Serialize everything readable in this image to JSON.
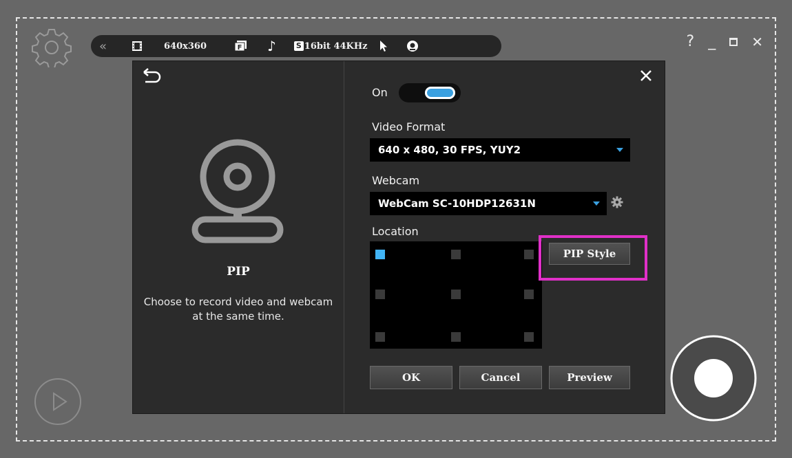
{
  "toolbar": {
    "collapse_icon": "double-chevron-left",
    "video_icon": "film-icon",
    "resolution": "640x360",
    "format_icon": "format-F-icon",
    "audio_icon": "music-note-icon",
    "audio_badge": "S",
    "audio_quality": "16bit 44KHz",
    "cursor_icon": "cursor-arrow-icon",
    "webcam_icon": "webcam-badge-icon"
  },
  "window": {
    "help": "?",
    "minimize": "_",
    "maximize": "□",
    "close": "✕"
  },
  "pip_panel": {
    "title": "PIP",
    "description": "Choose to record video and webcam at the same time."
  },
  "settings": {
    "on_label": "On",
    "toggle_on": true,
    "video_format_label": "Video Format",
    "video_format_value": "640 x 480, 30 FPS, YUY2",
    "webcam_label": "Webcam",
    "webcam_value": "WebCam SC-10HDP12631N",
    "location_label": "Location",
    "location_selected": "top-left",
    "pip_style_button": "PIP Style"
  },
  "actions": {
    "ok": "OK",
    "cancel": "Cancel",
    "preview": "Preview"
  },
  "colors": {
    "accent": "#3aa0e0",
    "selected_cell": "#41b4f5",
    "highlight": "#e030c8"
  }
}
